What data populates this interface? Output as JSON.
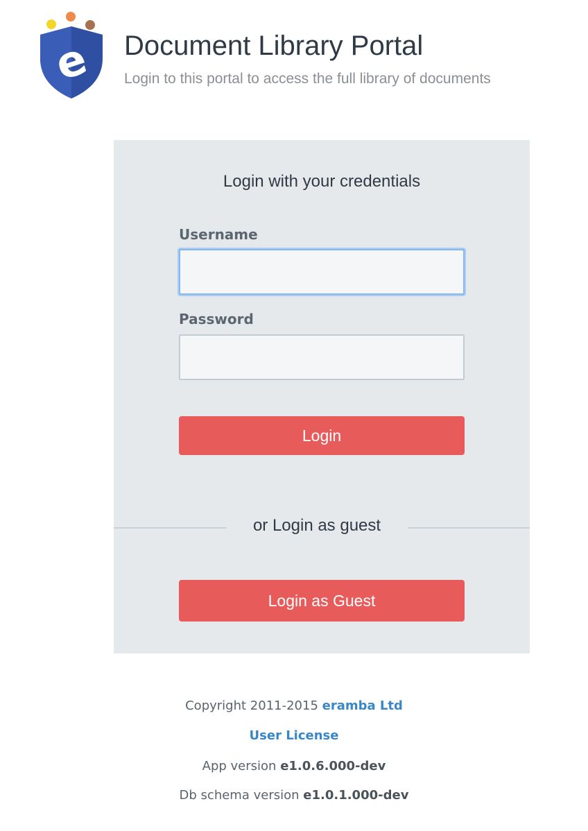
{
  "header": {
    "title": "Document Library Portal",
    "subtitle": "Login to this portal to access the full library of documents"
  },
  "logo": {
    "icon": "eramba-shield-logo-icon",
    "letter": "e",
    "colors": {
      "shield": "#2f4fa3",
      "dot_yellow": "#f2d629",
      "dot_orange": "#ef8a4a",
      "dot_brown": "#a5734f"
    }
  },
  "login_panel": {
    "heading": "Login with your credentials",
    "username": {
      "label": "Username",
      "value": "",
      "placeholder": ""
    },
    "password": {
      "label": "Password",
      "value": "",
      "placeholder": ""
    },
    "login_button": "Login",
    "divider_text": "or Login as guest",
    "guest_button": "Login as Guest"
  },
  "footer": {
    "copyright_prefix": "Copyright 2011-2015",
    "company_link": "eramba Ltd",
    "license_link": "User License",
    "app_version_label": "App version",
    "app_version": "e1.0.6.000-dev",
    "db_version_label": "Db schema version",
    "db_version": "e1.0.1.000-dev"
  },
  "colors": {
    "accent_button": "#e85b5b",
    "link": "#3a87c8",
    "panel_bg": "#e6e9ec",
    "focus_border": "#8ab8ec"
  }
}
